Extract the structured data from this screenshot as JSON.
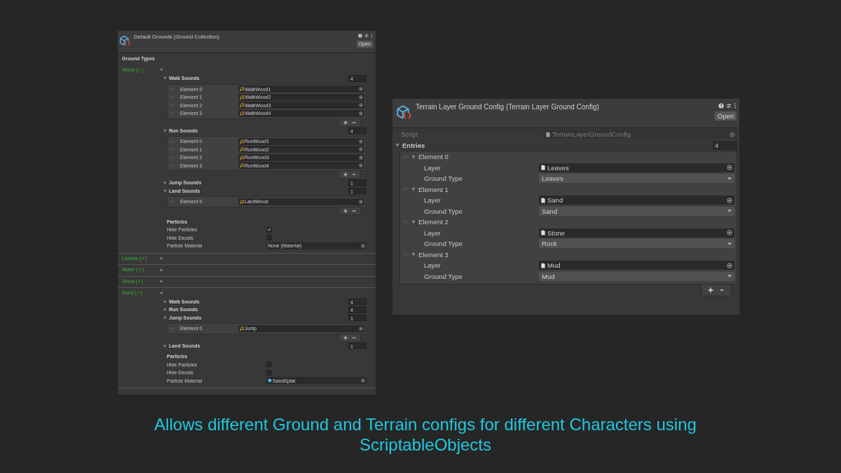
{
  "left_inspector": {
    "title": "Default Grounds (Ground Collection)",
    "open_button": "Open",
    "section": "Ground Types",
    "ground_types": [
      {
        "name": "Wood (✓)",
        "expanded": true,
        "sound_lists": [
          {
            "label": "Walk Sounds",
            "count": "4",
            "expanded": true,
            "elements": [
              {
                "label": "Element 0",
                "value": "WalkWood1"
              },
              {
                "label": "Element 1",
                "value": "WalkWood2"
              },
              {
                "label": "Element 2",
                "value": "WalkWood3"
              },
              {
                "label": "Element 3",
                "value": "WalkWood4"
              }
            ]
          },
          {
            "label": "Run Sounds",
            "count": "4",
            "expanded": true,
            "elements": [
              {
                "label": "Element 0",
                "value": "RunWood1"
              },
              {
                "label": "Element 1",
                "value": "RunWood2"
              },
              {
                "label": "Element 2",
                "value": "RunWood3"
              },
              {
                "label": "Element 3",
                "value": "RunWood4"
              }
            ]
          },
          {
            "label": "Jump Sounds",
            "count": "1",
            "expanded": false
          },
          {
            "label": "Land Sounds",
            "count": "1",
            "expanded": true,
            "elements": [
              {
                "label": "Element 0",
                "value": "LandWood"
              }
            ]
          }
        ],
        "particles": {
          "heading": "Particles",
          "toggles": [
            {
              "label": "Hide Particles",
              "checked": true
            },
            {
              "label": "Hide Decals",
              "checked": false
            }
          ],
          "material": {
            "label": "Particle Material",
            "value": "None (Material)",
            "kind": "none"
          }
        }
      },
      {
        "name": "Leaves (✓)",
        "expanded": false
      },
      {
        "name": "Water (✓)",
        "expanded": false
      },
      {
        "name": "Snow (✓)",
        "expanded": false
      },
      {
        "name": "Sand (✓)",
        "expanded": true,
        "sound_lists": [
          {
            "label": "Walk Sounds",
            "count": "4",
            "expanded": false
          },
          {
            "label": "Run Sounds",
            "count": "4",
            "expanded": false
          },
          {
            "label": "Jump Sounds",
            "count": "1",
            "expanded": true,
            "elements": [
              {
                "label": "Element 0",
                "value": "Jump"
              }
            ]
          },
          {
            "label": "Land Sounds",
            "count": "1",
            "expanded": false
          }
        ],
        "particles": {
          "heading": "Particles",
          "toggles": [
            {
              "label": "Hide Particles",
              "checked": false
            },
            {
              "label": "Hide Decals",
              "checked": false
            }
          ],
          "material": {
            "label": "Particle Material",
            "value": "SandSplat",
            "kind": "material"
          }
        }
      }
    ]
  },
  "right_inspector": {
    "title": "Terrain Layer Ground Config (Terrain Layer Ground Config)",
    "open_button": "Open",
    "script": {
      "label": "Script",
      "value": "TerrainLayerGroundConfig",
      "disabled": true
    },
    "entries": {
      "label": "Entries",
      "count": "4",
      "expanded": true,
      "elements": [
        {
          "label": "Element 0",
          "expanded": true,
          "layer_label": "Layer",
          "layer": "Leaves",
          "ground_type_label": "Ground Type",
          "ground_type": "Leaves"
        },
        {
          "label": "Element 1",
          "expanded": true,
          "layer_label": "Layer",
          "layer": "Sand",
          "ground_type_label": "Ground Type",
          "ground_type": "Sand"
        },
        {
          "label": "Element 2",
          "expanded": true,
          "layer_label": "Layer",
          "layer": "Stone",
          "ground_type_label": "Ground Type",
          "ground_type": "Rock"
        },
        {
          "label": "Element 3",
          "expanded": true,
          "layer_label": "Layer",
          "layer": "Mud",
          "ground_type_label": "Ground Type",
          "ground_type": "Mud"
        }
      ]
    }
  },
  "caption": "Allows different Ground and Terrain configs for different Characters using ScriptableObjects"
}
